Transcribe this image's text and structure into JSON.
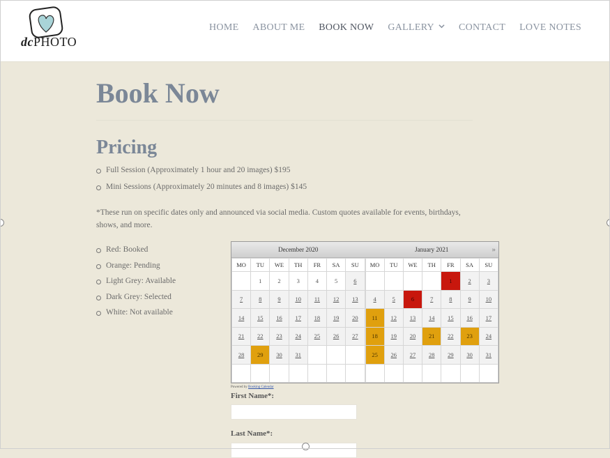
{
  "logo": {
    "text_dc": "dc",
    "text_photo": "PHOTO"
  },
  "nav": {
    "items": [
      {
        "label": "HOME"
      },
      {
        "label": "ABOUT ME"
      },
      {
        "label": "BOOK NOW"
      },
      {
        "label": "GALLERY"
      },
      {
        "label": "CONTACT"
      },
      {
        "label": "LOVE NOTES"
      }
    ],
    "active_index": 2
  },
  "page_title": "Book Now",
  "pricing": {
    "title": "Pricing",
    "items": [
      "Full Session (Approximately 1 hour and 20 images) $195",
      "Mini Sessions (Approximately 20 minutes and 8 images) $145"
    ],
    "note": "*These run on specific dates only and announced via social media. Custom quotes available for events, birthdays, shows, and more."
  },
  "legend": [
    "Red: Booked",
    "Orange: Pending",
    "Light Grey: Available",
    "Dark Grey: Selected",
    "White: Not available"
  ],
  "calendar": {
    "weekdays": [
      "MO",
      "TU",
      "WE",
      "TH",
      "FR",
      "SA",
      "SU"
    ],
    "next_label": "»",
    "months": [
      {
        "name": "December 2020",
        "weeks": [
          [
            [
              "",
              ""
            ],
            [
              "1",
              "plain"
            ],
            [
              "2",
              "plain"
            ],
            [
              "3",
              "plain"
            ],
            [
              "4",
              "plain"
            ],
            [
              "5",
              "plain"
            ],
            [
              "6",
              "avail"
            ]
          ],
          [
            [
              "7",
              "avail"
            ],
            [
              "8",
              "avail"
            ],
            [
              "9",
              "avail"
            ],
            [
              "10",
              "avail"
            ],
            [
              "11",
              "avail"
            ],
            [
              "12",
              "avail"
            ],
            [
              "13",
              "avail"
            ]
          ],
          [
            [
              "14",
              "avail"
            ],
            [
              "15",
              "avail"
            ],
            [
              "16",
              "avail"
            ],
            [
              "17",
              "avail"
            ],
            [
              "18",
              "avail"
            ],
            [
              "19",
              "avail"
            ],
            [
              "20",
              "avail"
            ]
          ],
          [
            [
              "21",
              "avail"
            ],
            [
              "22",
              "avail"
            ],
            [
              "23",
              "avail"
            ],
            [
              "24",
              "avail"
            ],
            [
              "25",
              "avail"
            ],
            [
              "26",
              "avail"
            ],
            [
              "27",
              "avail"
            ]
          ],
          [
            [
              "28",
              "avail"
            ],
            [
              "29",
              "pending"
            ],
            [
              "30",
              "avail"
            ],
            [
              "31",
              "avail"
            ],
            [
              "",
              ""
            ],
            [
              "",
              ""
            ],
            [
              "",
              ""
            ]
          ],
          [
            [
              "",
              ""
            ],
            [
              "",
              ""
            ],
            [
              "",
              ""
            ],
            [
              "",
              ""
            ],
            [
              "",
              ""
            ],
            [
              "",
              ""
            ],
            [
              "",
              ""
            ]
          ]
        ]
      },
      {
        "name": "January 2021",
        "weeks": [
          [
            [
              "",
              ""
            ],
            [
              "",
              ""
            ],
            [
              "",
              ""
            ],
            [
              "",
              ""
            ],
            [
              "1",
              "booked"
            ],
            [
              "2",
              "avail"
            ],
            [
              "3",
              "avail"
            ]
          ],
          [
            [
              "4",
              "avail"
            ],
            [
              "5",
              "avail"
            ],
            [
              "6",
              "booked"
            ],
            [
              "7",
              "avail"
            ],
            [
              "8",
              "avail"
            ],
            [
              "9",
              "avail"
            ],
            [
              "10",
              "avail"
            ]
          ],
          [
            [
              "11",
              "pending"
            ],
            [
              "12",
              "avail"
            ],
            [
              "13",
              "avail"
            ],
            [
              "14",
              "avail"
            ],
            [
              "15",
              "avail"
            ],
            [
              "16",
              "avail"
            ],
            [
              "17",
              "avail"
            ]
          ],
          [
            [
              "18",
              "pending"
            ],
            [
              "19",
              "avail"
            ],
            [
              "20",
              "avail"
            ],
            [
              "21",
              "pending"
            ],
            [
              "22",
              "avail"
            ],
            [
              "23",
              "pending"
            ],
            [
              "24",
              "avail"
            ]
          ],
          [
            [
              "25",
              "pending"
            ],
            [
              "26",
              "avail"
            ],
            [
              "27",
              "avail"
            ],
            [
              "28",
              "avail"
            ],
            [
              "29",
              "avail"
            ],
            [
              "30",
              "avail"
            ],
            [
              "31",
              "avail"
            ]
          ],
          [
            [
              "",
              ""
            ],
            [
              "",
              ""
            ],
            [
              "",
              ""
            ],
            [
              "",
              ""
            ],
            [
              "",
              ""
            ],
            [
              "",
              ""
            ],
            [
              "",
              ""
            ]
          ]
        ]
      }
    ]
  },
  "powered": {
    "prefix": "Powered by ",
    "link": "Booking Calendar"
  },
  "form": {
    "first_name_label": "First Name*:",
    "last_name_label": "Last Name*:"
  }
}
